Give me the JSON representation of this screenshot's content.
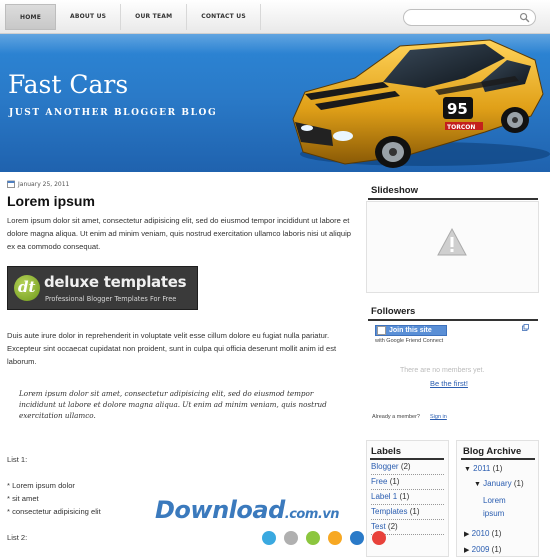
{
  "nav": {
    "items": [
      "HOME",
      "ABOUT US",
      "OUR TEAM",
      "CONTACT US"
    ]
  },
  "search": {
    "placeholder": ""
  },
  "header": {
    "title": "Fast Cars",
    "description": "JUST ANOTHER BLOGGER BLOG",
    "car_number": "95",
    "car_sponsor": "TORCON"
  },
  "post": {
    "date": "January 25, 2011",
    "title": "Lorem ipsum",
    "paragraph1": "Lorem ipsum dolor sit amet, consectetur adipisicing elit, sed do eiusmod tempor incididunt ut labore et dolore magna aliqua. Ut enim ad minim veniam, quis nostrud exercitation ullamco laboris nisi ut aliquip ex ea commodo consequat.",
    "banner_title": "deluxe templates",
    "banner_subtitle": "Professional Blogger Templates For Free",
    "banner_logo_letter": "dt",
    "paragraph2": "Duis aute irure dolor in reprehenderit in voluptate velit esse cillum dolore eu fugiat nulla pariatur. Excepteur sint occaecat cupidatat non proident, sunt in culpa qui officia deserunt mollit anim id est laborum.",
    "quote": "Lorem ipsum dolor sit amet, consectetur adipisicing elit, sed do eiusmod tempor incididunt ut labore et dolore magna aliqua. Ut enim ad minim veniam, quis nostrud exercitation ullamco.",
    "list1_label": "List 1:",
    "list1_items": [
      "* Lorem ipsum dolor",
      "* sit amet",
      "* consectetur adipisicing elit"
    ],
    "list2_label": "List 2:"
  },
  "sidebar": {
    "slideshow_title": "Slideshow",
    "followers_title": "Followers",
    "join_label": "Join this site",
    "gfc_label": "with Google Friend Connect",
    "no_members": "There are no members yet.",
    "be_first": "Be the first!",
    "already_member": "Already a member?",
    "sign_in": "Sign in",
    "labels_title": "Labels",
    "labels": [
      {
        "name": "Blogger",
        "count": "(2)"
      },
      {
        "name": "Free",
        "count": "(1)"
      },
      {
        "name": "Label 1",
        "count": "(1)"
      },
      {
        "name": "Templates",
        "count": "(1)"
      },
      {
        "name": "Test",
        "count": "(2)"
      }
    ],
    "archive_title": "Blog Archive",
    "archive": {
      "y2011": "2011",
      "y2011_count": "(1)",
      "jan": "January",
      "jan_count": "(1)",
      "post": "Lorem ipsum",
      "y2010": "2010",
      "y2010_count": "(1)",
      "y2009": "2009",
      "y2009_count": "(1)"
    }
  },
  "watermark": {
    "text": "Download",
    "suffix": ".com.vn"
  },
  "colors": {
    "header_blue": "#2a7ac8",
    "car_yellow": "#e0a018",
    "link_blue": "#2a5db0",
    "dots": [
      "#3aa9e0",
      "#b0b0b0",
      "#8cc63f",
      "#f7a823",
      "#2a7ac8",
      "#e8423b"
    ]
  }
}
